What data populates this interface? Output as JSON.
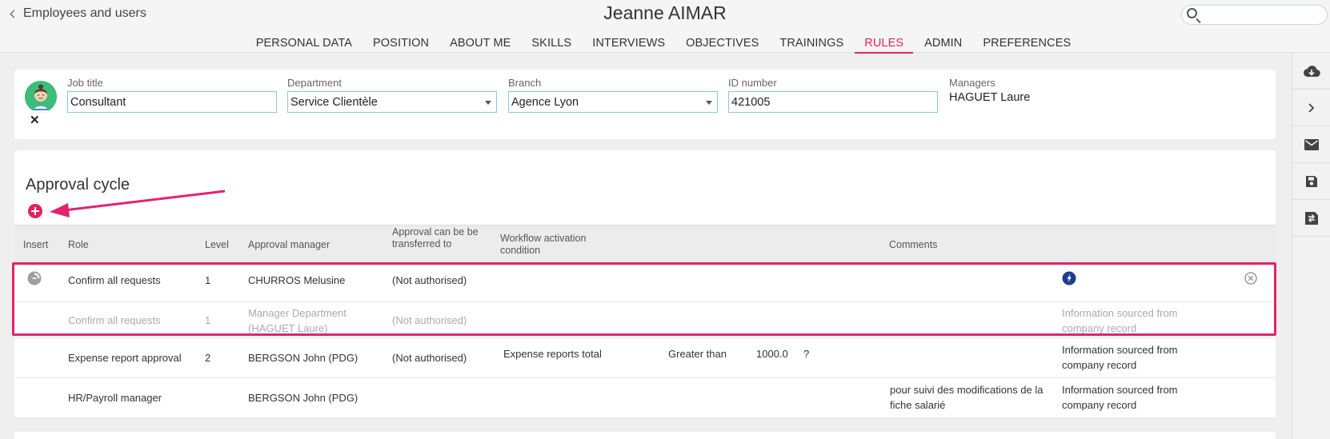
{
  "header": {
    "back_label": "Employees and users",
    "title": "Jeanne AIMAR",
    "search_placeholder": ""
  },
  "tabs": [
    {
      "label": "PERSONAL DATA",
      "active": false
    },
    {
      "label": "POSITION",
      "active": false
    },
    {
      "label": "ABOUT ME",
      "active": false
    },
    {
      "label": "SKILLS",
      "active": false
    },
    {
      "label": "INTERVIEWS",
      "active": false
    },
    {
      "label": "OBJECTIVES",
      "active": false
    },
    {
      "label": "TRAININGS",
      "active": false
    },
    {
      "label": "RULES",
      "active": true
    },
    {
      "label": "ADMIN",
      "active": false
    },
    {
      "label": "PREFERENCES",
      "active": false
    }
  ],
  "employee": {
    "job_title_label": "Job title",
    "job_title_value": "Consultant",
    "department_label": "Department",
    "department_value": "Service Clientèle",
    "branch_label": "Branch",
    "branch_value": "Agence Lyon",
    "id_label": "ID number",
    "id_value": "421005",
    "managers_label": "Managers",
    "managers_value": "HAGUET Laure",
    "close_glyph": "✕"
  },
  "approval": {
    "title": "Approval cycle",
    "columns": {
      "insert": "Insert",
      "role": "Role",
      "level": "Level",
      "manager": "Approval manager",
      "transfer": "Approval can be be transferred to",
      "workflow": "Workflow activation condition",
      "comments": "Comments"
    },
    "rows": [
      {
        "role": "Confirm all requests",
        "level": "1",
        "manager": "CHURROS Melusine",
        "transfer": "(Not authorised)",
        "condition_field": "",
        "condition_op": "",
        "condition_value": "",
        "condition_help": "",
        "comments": "",
        "source": ""
      },
      {
        "role": "Confirm all requests",
        "level": "1",
        "manager": "Manager Department (HAGUET Laure)",
        "transfer": "(Not authorised)",
        "condition_field": "",
        "condition_op": "",
        "condition_value": "",
        "condition_help": "",
        "comments": "",
        "source": "Information sourced from company record"
      },
      {
        "role": "Expense report approval",
        "level": "2",
        "manager": "BERGSON John (PDG)",
        "transfer": "(Not authorised)",
        "condition_field": "Expense reports total",
        "condition_op": "Greater than",
        "condition_value": "1000.0",
        "condition_help": "?",
        "comments": "",
        "source": "Information sourced from company record"
      },
      {
        "role": "HR/Payroll manager",
        "level": "",
        "manager": "BERGSON John (PDG)",
        "transfer": "",
        "condition_field": "",
        "condition_op": "",
        "condition_value": "",
        "condition_help": "",
        "comments": "pour suivi des modifications de la fiche salarié",
        "source": "Information sourced from company record"
      }
    ]
  },
  "colors": {
    "accent": "#e0245e",
    "highlight": "#e0246e",
    "field_border": "#8fc3dd",
    "info_icon": "#1b3d8f"
  },
  "icons": {
    "rail": [
      "cloud-download-icon",
      "chevron-right-icon",
      "mail-icon",
      "save-icon",
      "save-and-close-icon"
    ]
  }
}
